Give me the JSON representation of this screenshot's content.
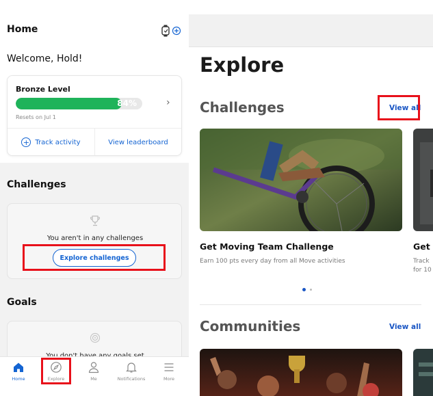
{
  "home": {
    "title": "Home",
    "welcome": "Welcome, Hold!",
    "level_card": {
      "level_name": "Bronze Level",
      "progress_percent": 84,
      "progress_label": "84%",
      "resets": "Resets on Jul 1",
      "track_activity": "Track activity",
      "view_leaderboard": "View leaderboard"
    },
    "challenges": {
      "title": "Challenges",
      "empty_text": "You aren't in any challenges",
      "explore_button": "Explore challenges"
    },
    "goals": {
      "title": "Goals",
      "empty_text": "You don't have any goals set"
    },
    "tabs": [
      {
        "label": "Home",
        "icon": "home-icon",
        "active": true
      },
      {
        "label": "Explore",
        "icon": "compass-icon",
        "active": false
      },
      {
        "label": "Me",
        "icon": "person-icon",
        "active": false
      },
      {
        "label": "Notifications",
        "icon": "bell-icon",
        "active": false
      },
      {
        "label": "More",
        "icon": "menu-icon",
        "active": false
      }
    ]
  },
  "explore": {
    "title": "Explore",
    "challenges": {
      "title": "Challenges",
      "view_all": "View all",
      "items": [
        {
          "name": "Get Moving Team Challenge",
          "description": "Earn 100 pts every day from all Move activities"
        },
        {
          "name": "Get",
          "description": "Track\nfor 10"
        }
      ]
    },
    "communities": {
      "title": "Communities",
      "view_all": "View all"
    }
  },
  "colors": {
    "accent_blue": "#1464d2",
    "progress_green": "#1fb35a",
    "highlight_red": "#e8101a"
  }
}
